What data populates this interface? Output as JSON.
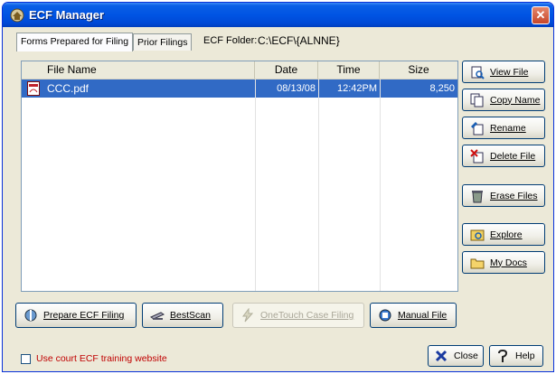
{
  "window": {
    "title": "ECF Manager",
    "close_glyph": "✕"
  },
  "tabs": [
    {
      "label": "Forms Prepared for Filing"
    },
    {
      "label": "Prior Filings"
    }
  ],
  "folder": {
    "label": "ECF Folder:",
    "value": "C:\\ECF\\{ALNNE}"
  },
  "list": {
    "columns": [
      "File Name",
      "Date",
      "Time",
      "Size"
    ],
    "rows": [
      {
        "name": "CCC.pdf",
        "date": "08/13/08",
        "time": "12:42PM",
        "size": "8,250",
        "icon": "pdf-file-icon"
      }
    ]
  },
  "side_buttons": [
    {
      "label": "View File",
      "icon": "view-file-icon"
    },
    {
      "label": "Copy Name",
      "icon": "copy-name-icon"
    },
    {
      "label": "Rename",
      "icon": "rename-icon"
    },
    {
      "label": "Delete File",
      "icon": "delete-file-icon"
    },
    {
      "label": "Erase Files",
      "icon": "erase-files-icon"
    },
    {
      "label": "Explore",
      "icon": "explore-icon"
    },
    {
      "label": "My Docs",
      "icon": "my-docs-icon"
    }
  ],
  "bottom_buttons": [
    {
      "label": "Prepare ECF Filing",
      "icon": "prepare-filing-icon",
      "enabled": true
    },
    {
      "label": "BestScan",
      "icon": "scanner-icon",
      "enabled": true
    },
    {
      "label": "OneTouch Case Filing",
      "icon": "lightning-icon",
      "enabled": false
    },
    {
      "label": "Manual File",
      "icon": "manual-file-icon",
      "enabled": true
    }
  ],
  "checkbox": {
    "label": "Use court ECF training website",
    "checked": false
  },
  "footer_buttons": [
    {
      "label": "Close",
      "icon": "close-x-icon"
    },
    {
      "label": "Help",
      "icon": "help-icon"
    }
  ],
  "colors": {
    "selection": "#316ac5",
    "titlebar": "#0054e3",
    "checkbox_label": "#c00000"
  }
}
